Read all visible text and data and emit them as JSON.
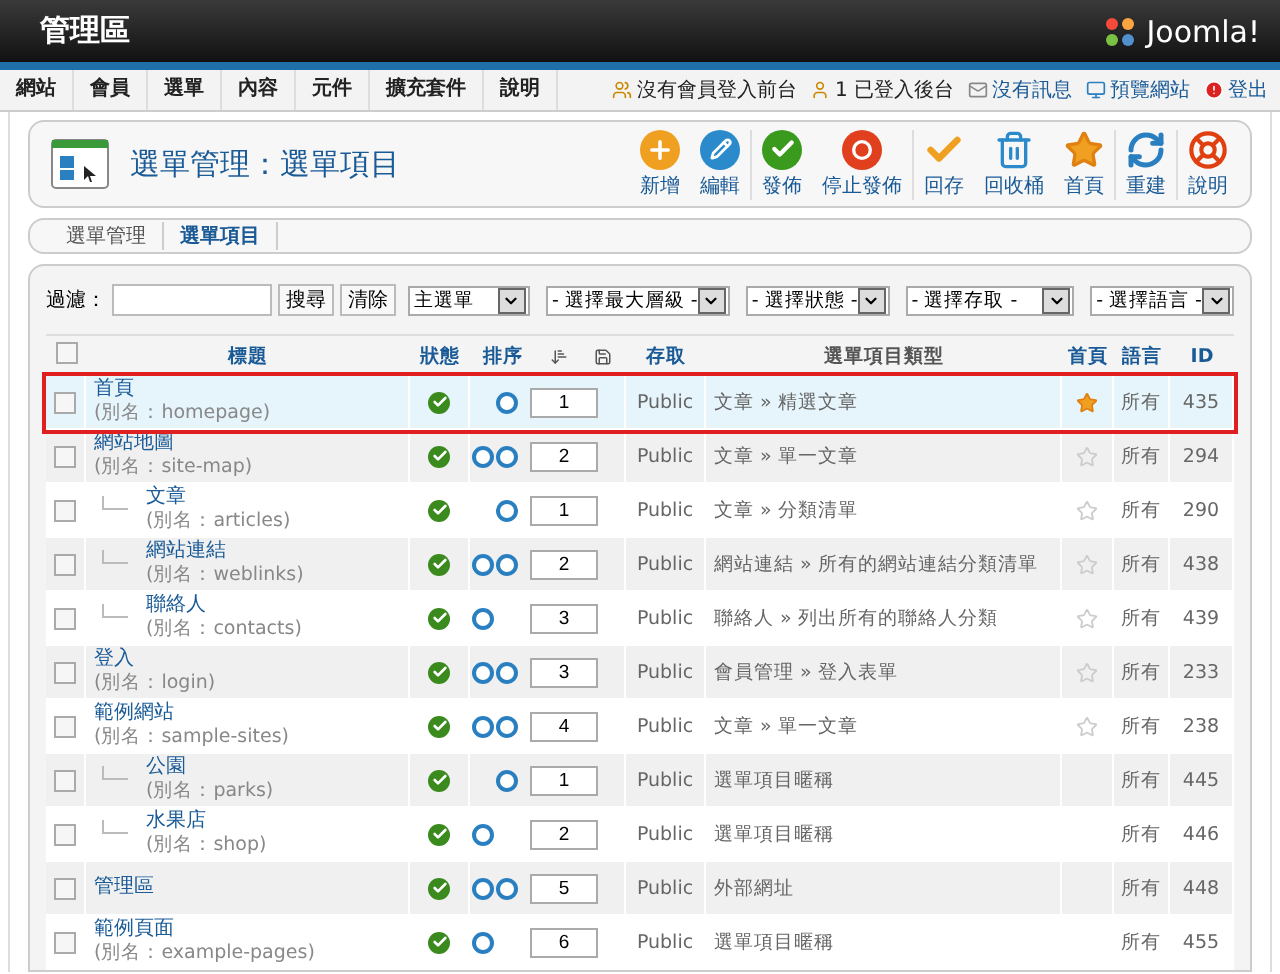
{
  "header": {
    "title": "管理區",
    "logo": "Joomla!"
  },
  "menu": [
    "網站",
    "會員",
    "選單",
    "內容",
    "元件",
    "擴充套件",
    "說明"
  ],
  "status_links": [
    {
      "kind": "users",
      "label": "沒有會員登入前台"
    },
    {
      "kind": "user",
      "label": "1 已登入後台"
    },
    {
      "kind": "mail",
      "label": "沒有訊息"
    },
    {
      "kind": "preview",
      "label": "預覽網站"
    },
    {
      "kind": "logout",
      "label": "登出"
    }
  ],
  "page_title": "選單管理：選單項目",
  "toolbar": [
    {
      "kind": "new",
      "label": "新增"
    },
    {
      "kind": "edit",
      "label": "編輯"
    },
    {
      "kind": "publish",
      "label": "發佈"
    },
    {
      "kind": "unpublish",
      "label": "停止發佈"
    },
    {
      "kind": "checkin",
      "label": "回存"
    },
    {
      "kind": "trash",
      "label": "回收桶"
    },
    {
      "kind": "home",
      "label": "首頁"
    },
    {
      "kind": "rebuild",
      "label": "重建"
    },
    {
      "kind": "help",
      "label": "說明"
    }
  ],
  "subtabs": [
    {
      "label": "選單管理",
      "selected": false
    },
    {
      "label": "選單項目",
      "selected": true
    }
  ],
  "filter": {
    "label": "過濾：",
    "buttons": [
      "搜尋",
      "清除"
    ],
    "selects": [
      "主選單",
      "- 選擇最大層級 -",
      "- 選擇狀態 -",
      "- 選擇存取 -",
      "- 選擇語言 -"
    ]
  },
  "table": {
    "select_all": {
      "checked": false
    },
    "columns": {
      "title": "標題",
      "status": "狀態",
      "order": "排序",
      "access": "存取",
      "type": "選單項目類型",
      "home": "首頁",
      "language": "語言",
      "id": "ID"
    },
    "rows": [
      {
        "checked": false,
        "title": "首頁",
        "alias": "(別名：homepage)",
        "published": true,
        "up": false,
        "down": true,
        "order": "1",
        "access": "Public",
        "type": "文章 » 精選文章",
        "home": true,
        "language": "所有",
        "id": "435",
        "selected": true
      },
      {
        "checked": false,
        "title": "網站地圖",
        "alias": "(別名：site-map)",
        "published": true,
        "up": true,
        "down": true,
        "order": "2",
        "access": "Public",
        "type": "文章 » 單一文章",
        "home": false,
        "language": "所有",
        "id": "294",
        "selected": false,
        "children": [
          {
            "checked": false,
            "title": "文章",
            "alias": "(別名：articles)",
            "published": true,
            "up": false,
            "down": true,
            "order": "1",
            "access": "Public",
            "type": "文章 » 分類清單",
            "home": false,
            "language": "所有",
            "id": "290",
            "selected": false
          },
          {
            "checked": false,
            "title": "網站連結",
            "alias": "(別名：weblinks)",
            "published": true,
            "up": true,
            "down": true,
            "order": "2",
            "access": "Public",
            "type": "網站連結 » 所有的網站連結分類清單",
            "home": false,
            "language": "所有",
            "id": "438",
            "selected": false
          },
          {
            "checked": false,
            "title": "聯絡人",
            "alias": "(別名：contacts)",
            "published": true,
            "up": true,
            "down": false,
            "order": "3",
            "access": "Public",
            "type": "聯絡人 » 列出所有的聯絡人分類",
            "home": false,
            "language": "所有",
            "id": "439",
            "selected": false
          }
        ]
      },
      {
        "checked": false,
        "title": "登入",
        "alias": "(別名：login)",
        "published": true,
        "up": true,
        "down": true,
        "order": "3",
        "access": "Public",
        "type": "會員管理 » 登入表單",
        "home": false,
        "language": "所有",
        "id": "233",
        "selected": false
      },
      {
        "checked": false,
        "title": "範例網站",
        "alias": "(別名：sample-sites)",
        "published": true,
        "up": true,
        "down": true,
        "order": "4",
        "access": "Public",
        "type": "文章 » 單一文章",
        "home": false,
        "language": "所有",
        "id": "238",
        "selected": false,
        "children": [
          {
            "checked": false,
            "title": "公園",
            "alias": "(別名：parks)",
            "published": true,
            "up": false,
            "down": true,
            "order": "1",
            "access": "Public",
            "type": "選單項目暱稱",
            "language": "所有",
            "id": "445",
            "selected": false
          },
          {
            "checked": false,
            "title": "水果店",
            "alias": "(別名：shop)",
            "published": true,
            "up": true,
            "down": false,
            "order": "2",
            "access": "Public",
            "type": "選單項目暱稱",
            "language": "所有",
            "id": "446",
            "selected": false
          }
        ]
      },
      {
        "checked": false,
        "title": "管理區",
        "published": true,
        "up": true,
        "down": true,
        "order": "5",
        "access": "Public",
        "type": "外部網址",
        "language": "所有",
        "id": "448",
        "selected": false
      },
      {
        "checked": false,
        "title": "範例頁面",
        "alias": "(別名：example-pages)",
        "published": true,
        "up": true,
        "down": false,
        "order": "6",
        "access": "Public",
        "type": "選單項目暱稱",
        "language": "所有",
        "id": "455",
        "selected": false
      }
    ]
  }
}
